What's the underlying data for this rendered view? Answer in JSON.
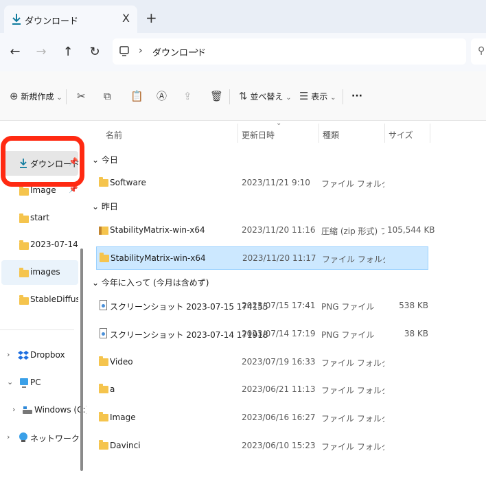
{
  "tab": {
    "title": "ダウンロード",
    "close": "X",
    "new_tab": "+"
  },
  "nav": {
    "back": "←",
    "forward": "→",
    "up": "↑",
    "refresh": "↻"
  },
  "address": {
    "chevron": "›",
    "location": "ダウンロード"
  },
  "toolbar": {
    "new_label": "新規作成",
    "sort_label": "並べ替え",
    "view_label": "表示",
    "more_label": "···",
    "dropdown": "⌄"
  },
  "sidebar": {
    "quick": [
      {
        "label": "ダウンロード",
        "pinned": true
      },
      {
        "label": "Image",
        "pinned": true
      },
      {
        "label": "start",
        "pinned": false
      },
      {
        "label": "2023-07-14",
        "pinned": false
      },
      {
        "label": "images",
        "pinned": false
      },
      {
        "label": "StableDiffusion",
        "pinned": false
      }
    ],
    "tree": [
      {
        "label": "Dropbox",
        "chevron": "›"
      },
      {
        "label": "PC",
        "chevron": "⌄"
      },
      {
        "label": "Windows (C:)",
        "chevron": "›"
      },
      {
        "label": "ネットワーク",
        "chevron": "›"
      }
    ]
  },
  "columns": {
    "name": "名前",
    "modified": "更新日時",
    "type": "種類",
    "size": "サイズ"
  },
  "groups": [
    {
      "label": "今日",
      "files": [
        {
          "name": "Software",
          "date": "2023/11/21 9:10",
          "type": "ファイル フォルダー",
          "size": "",
          "kind": "folder"
        }
      ]
    },
    {
      "label": "昨日",
      "files": [
        {
          "name": "StabilityMatrix-win-x64",
          "date": "2023/11/20 11:16",
          "type": "圧縮 (zip 形式) フォ...",
          "size": "105,544 KB",
          "kind": "zip"
        },
        {
          "name": "StabilityMatrix-win-x64",
          "date": "2023/11/20 11:17",
          "type": "ファイル フォルダー",
          "size": "",
          "kind": "folder"
        }
      ]
    },
    {
      "label": "今年に入って (今月は含めず)",
      "files": [
        {
          "name": "スクリーンショット 2023-07-15 174155",
          "date": "2023/07/15 17:41",
          "type": "PNG ファイル",
          "size": "538 KB",
          "kind": "png"
        },
        {
          "name": "スクリーンショット 2023-07-14 171918",
          "date": "2023/07/14 17:19",
          "type": "PNG ファイル",
          "size": "38 KB",
          "kind": "png"
        },
        {
          "name": "Video",
          "date": "2023/07/19 16:33",
          "type": "ファイル フォルダー",
          "size": "",
          "kind": "folder"
        },
        {
          "name": "a",
          "date": "2023/06/21 11:13",
          "type": "ファイル フォルダー",
          "size": "",
          "kind": "folder"
        },
        {
          "name": "Image",
          "date": "2023/06/16 16:27",
          "type": "ファイル フォルダー",
          "size": "",
          "kind": "folder"
        },
        {
          "name": "Davinci",
          "date": "2023/06/10 15:23",
          "type": "ファイル フォルダー",
          "size": "",
          "kind": "folder"
        }
      ]
    }
  ],
  "colors": {
    "accent": "#0f7b9e",
    "highlight_ring": "#ff2a12",
    "selection": "#cce8ff",
    "folder": "#f5c44d"
  }
}
